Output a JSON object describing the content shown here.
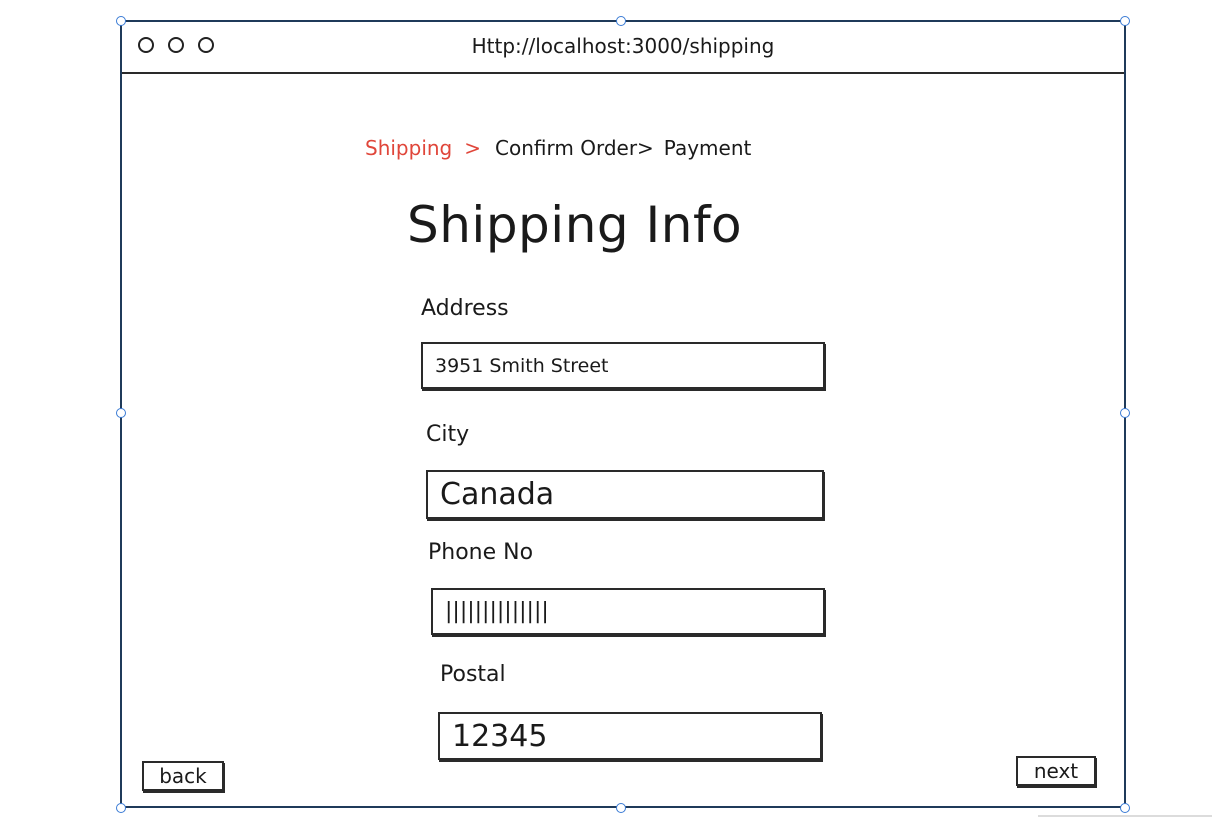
{
  "window": {
    "url": "Http://localhost:3000/shipping"
  },
  "breadcrumb": {
    "steps": [
      "Shipping",
      "Confirm Order>",
      "Payment"
    ],
    "separator": ">",
    "active_color": "#e0463a"
  },
  "page": {
    "title": "Shipping Info"
  },
  "form": {
    "address": {
      "label": "Address",
      "value": "3951 Smith Street"
    },
    "city": {
      "label": "City",
      "value": "Canada"
    },
    "phone": {
      "label": "Phone No",
      "value": "||||||||||||||"
    },
    "postal": {
      "label": "Postal",
      "value": "12345"
    }
  },
  "buttons": {
    "back": "back",
    "next": "next"
  }
}
